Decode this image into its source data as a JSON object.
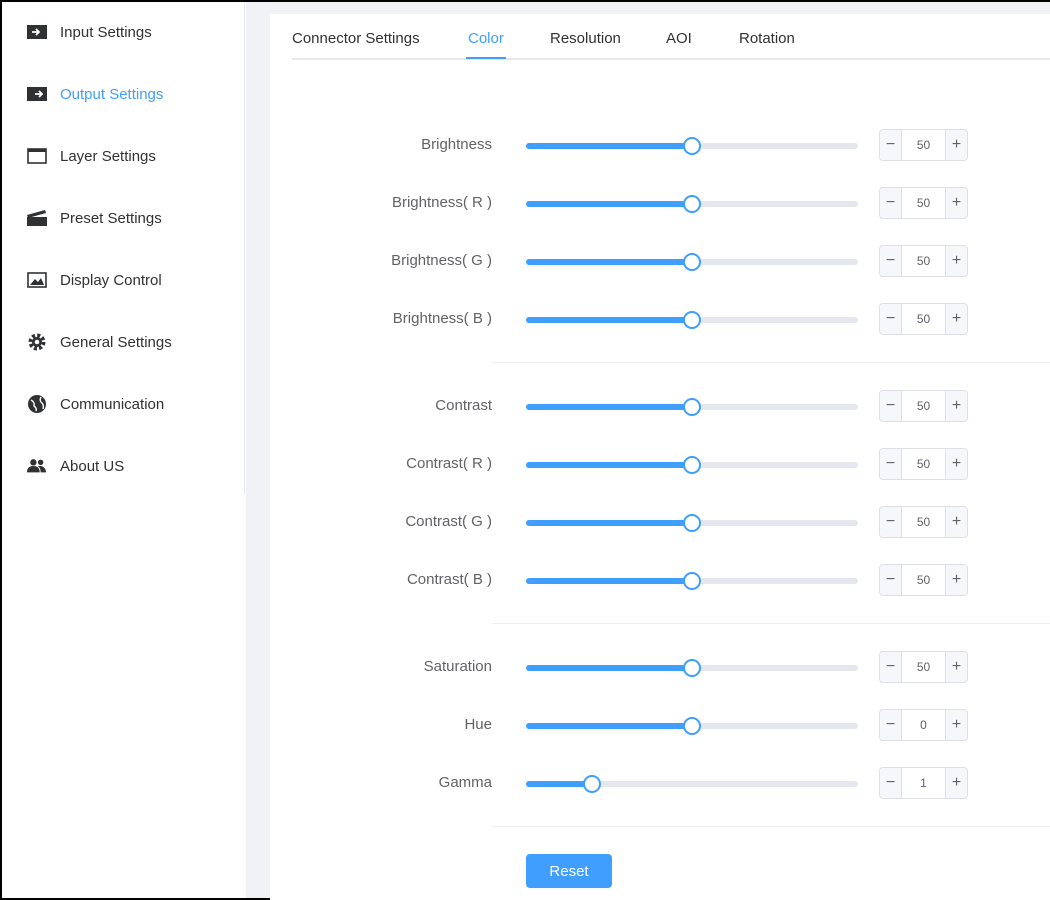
{
  "sidebar": {
    "items": [
      {
        "label": "Input Settings",
        "icon": "input-icon",
        "active": false
      },
      {
        "label": "Output Settings",
        "icon": "output-icon",
        "active": true
      },
      {
        "label": "Layer Settings",
        "icon": "layer-icon",
        "active": false
      },
      {
        "label": "Preset Settings",
        "icon": "preset-icon",
        "active": false
      },
      {
        "label": "Display Control",
        "icon": "display-image-icon",
        "active": false
      },
      {
        "label": "General Settings",
        "icon": "gear-icon",
        "active": false
      },
      {
        "label": "Communication",
        "icon": "globe-icon",
        "active": false
      },
      {
        "label": "About US",
        "icon": "users-icon",
        "active": false
      }
    ]
  },
  "tabs": [
    {
      "label": "Connector Settings",
      "active": false
    },
    {
      "label": "Color",
      "active": true
    },
    {
      "label": "Resolution",
      "active": false
    },
    {
      "label": "AOI",
      "active": false
    },
    {
      "label": "Rotation",
      "active": false
    }
  ],
  "color": {
    "brightness": {
      "label": "Brightness",
      "value": "50",
      "fraction": 0.5
    },
    "brightness_r": {
      "label": "Brightness( R )",
      "value": "50",
      "fraction": 0.5
    },
    "brightness_g": {
      "label": "Brightness( G )",
      "value": "50",
      "fraction": 0.5
    },
    "brightness_b": {
      "label": "Brightness( B )",
      "value": "50",
      "fraction": 0.5
    },
    "contrast": {
      "label": "Contrast",
      "value": "50",
      "fraction": 0.5
    },
    "contrast_r": {
      "label": "Contrast( R )",
      "value": "50",
      "fraction": 0.5
    },
    "contrast_g": {
      "label": "Contrast( G )",
      "value": "50",
      "fraction": 0.5
    },
    "contrast_b": {
      "label": "Contrast( B )",
      "value": "50",
      "fraction": 0.5
    },
    "saturation": {
      "label": "Saturation",
      "value": "50",
      "fraction": 0.5
    },
    "hue": {
      "label": "Hue",
      "value": "0",
      "fraction": 0.5
    },
    "gamma": {
      "label": "Gamma",
      "value": "1",
      "fraction": 0.2
    }
  },
  "stepper": {
    "minus": "−",
    "plus": "+"
  },
  "reset_label": "Reset",
  "colors": {
    "accent": "#409eff",
    "track": "#e4e7ed",
    "text": "#303133"
  }
}
